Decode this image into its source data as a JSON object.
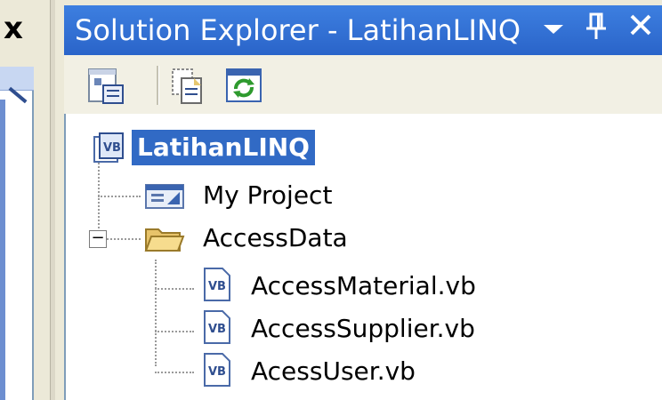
{
  "left_panel": {
    "close_glyph": "x"
  },
  "solution_explorer": {
    "title": "Solution Explorer - LatihanLINQ",
    "controls": {
      "dropdown": "▼",
      "pin": "ᚱ",
      "close": "✕"
    },
    "toolbar": [
      {
        "name": "properties-icon"
      },
      {
        "name": "show-all-files-icon"
      },
      {
        "name": "refresh-icon"
      }
    ],
    "tree": {
      "root": {
        "label": "LatihanLINQ",
        "icon": "vb-project-icon"
      },
      "items": [
        {
          "label": "My Project",
          "icon": "my-project-icon"
        },
        {
          "label": "AccessData",
          "icon": "folder-open-icon",
          "expanded": true,
          "children": [
            {
              "label": "AccessMaterial.vb",
              "icon": "vb-file-icon"
            },
            {
              "label": "AccessSupplier.vb",
              "icon": "vb-file-icon"
            },
            {
              "label": "AcessUser.vb",
              "icon": "vb-file-icon"
            }
          ]
        }
      ],
      "expander_glyph": "−"
    },
    "colors": {
      "title_bar": "#2a64c9",
      "selection": "#316ac5"
    }
  }
}
